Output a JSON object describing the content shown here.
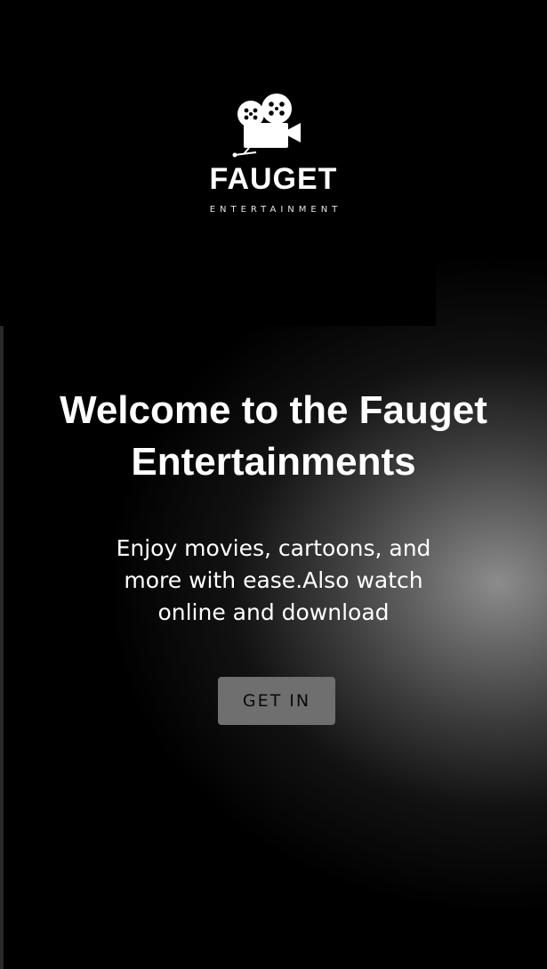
{
  "logo": {
    "icon": "movie-camera-icon",
    "name": "FAUGET",
    "tagline": "ENTERTAINMENT"
  },
  "hero": {
    "title": "Welcome to the Fauget Entertainments",
    "subtitle": "Enjoy movies, cartoons, and more with ease.Also watch online and download"
  },
  "actions": {
    "get_in_label": "GET IN"
  },
  "colors": {
    "background": "#000000",
    "button": "#6f6f6f",
    "text": "#ffffff"
  }
}
